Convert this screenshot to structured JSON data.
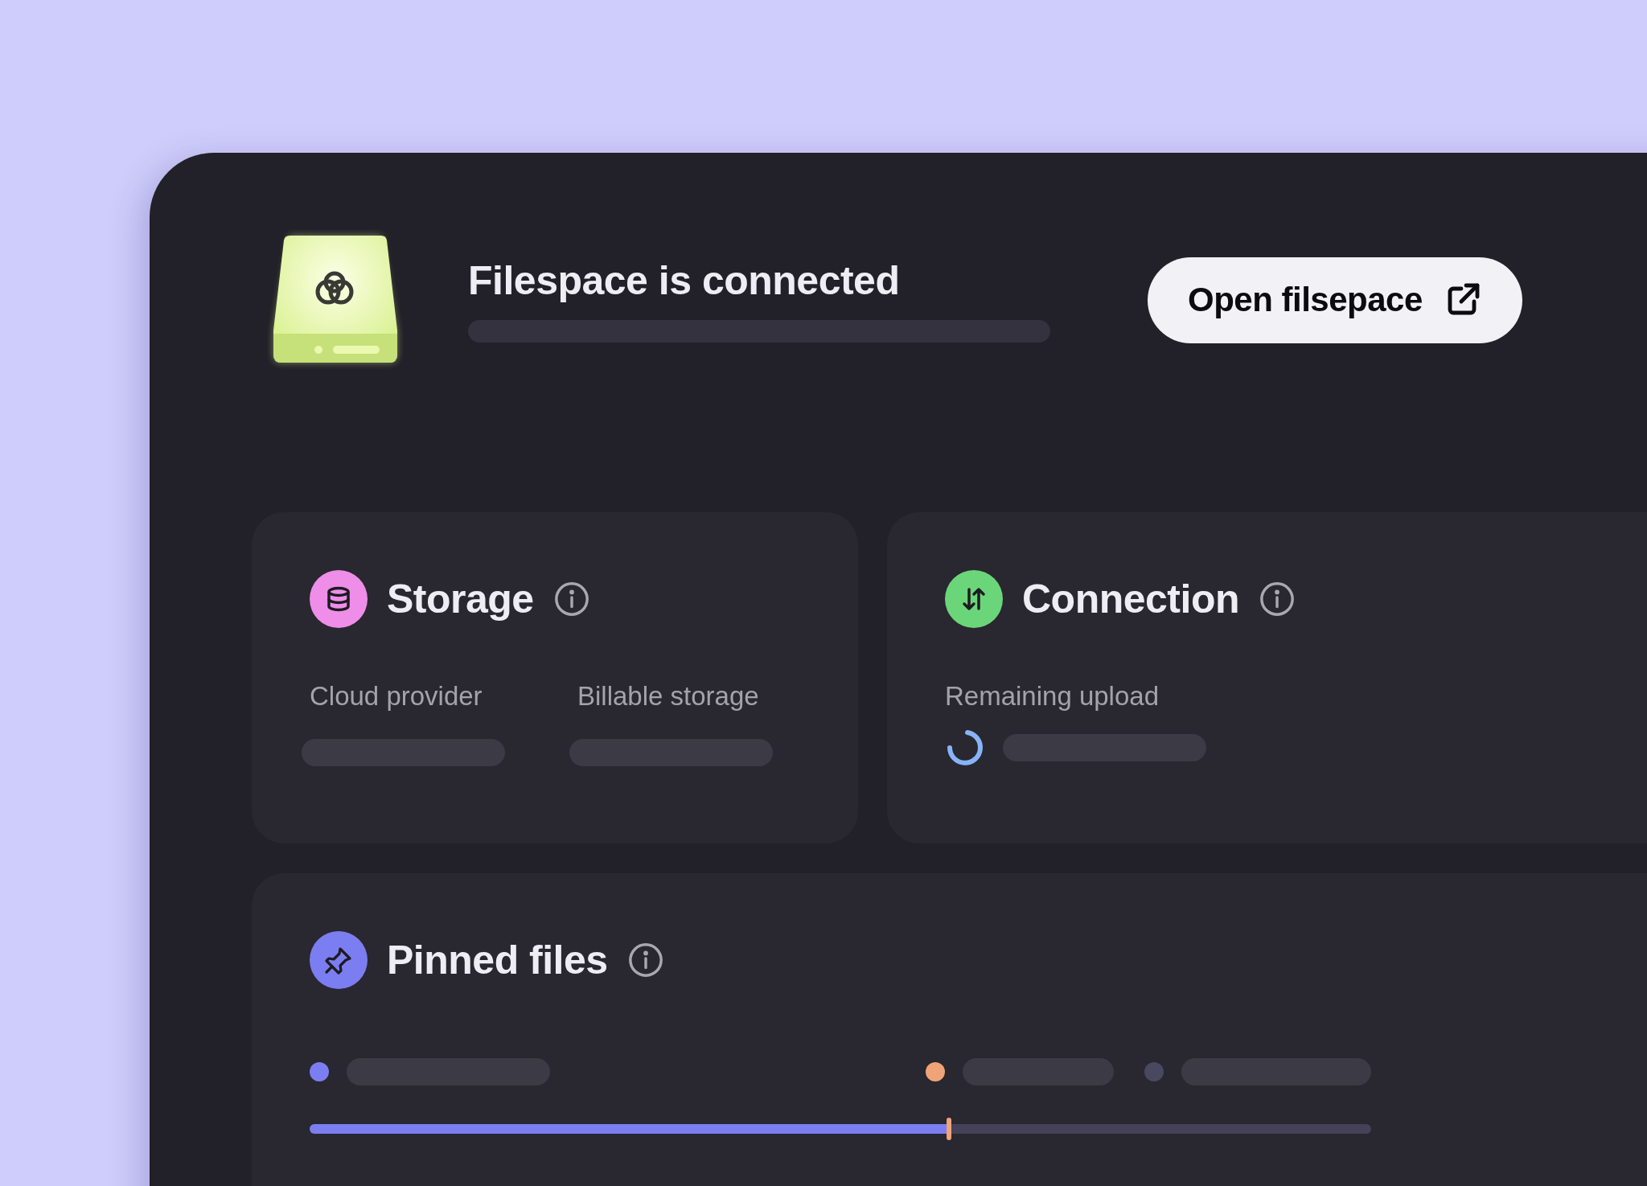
{
  "header": {
    "title": "Filespace is connected",
    "button": "Open filsepace"
  },
  "storage": {
    "title": "Storage",
    "fields": [
      {
        "label": "Cloud provider"
      },
      {
        "label": "Billable storage"
      }
    ]
  },
  "connection": {
    "title": "Connection",
    "fields": [
      {
        "label": "Remaining upload",
        "loading": true
      }
    ]
  },
  "pinned_files": {
    "title": "Pinned files",
    "legend": [
      {
        "color": "#7b7ef0"
      },
      {
        "color": "#eea477"
      },
      {
        "color": "#4a4860"
      }
    ],
    "level": 0.6
  }
}
